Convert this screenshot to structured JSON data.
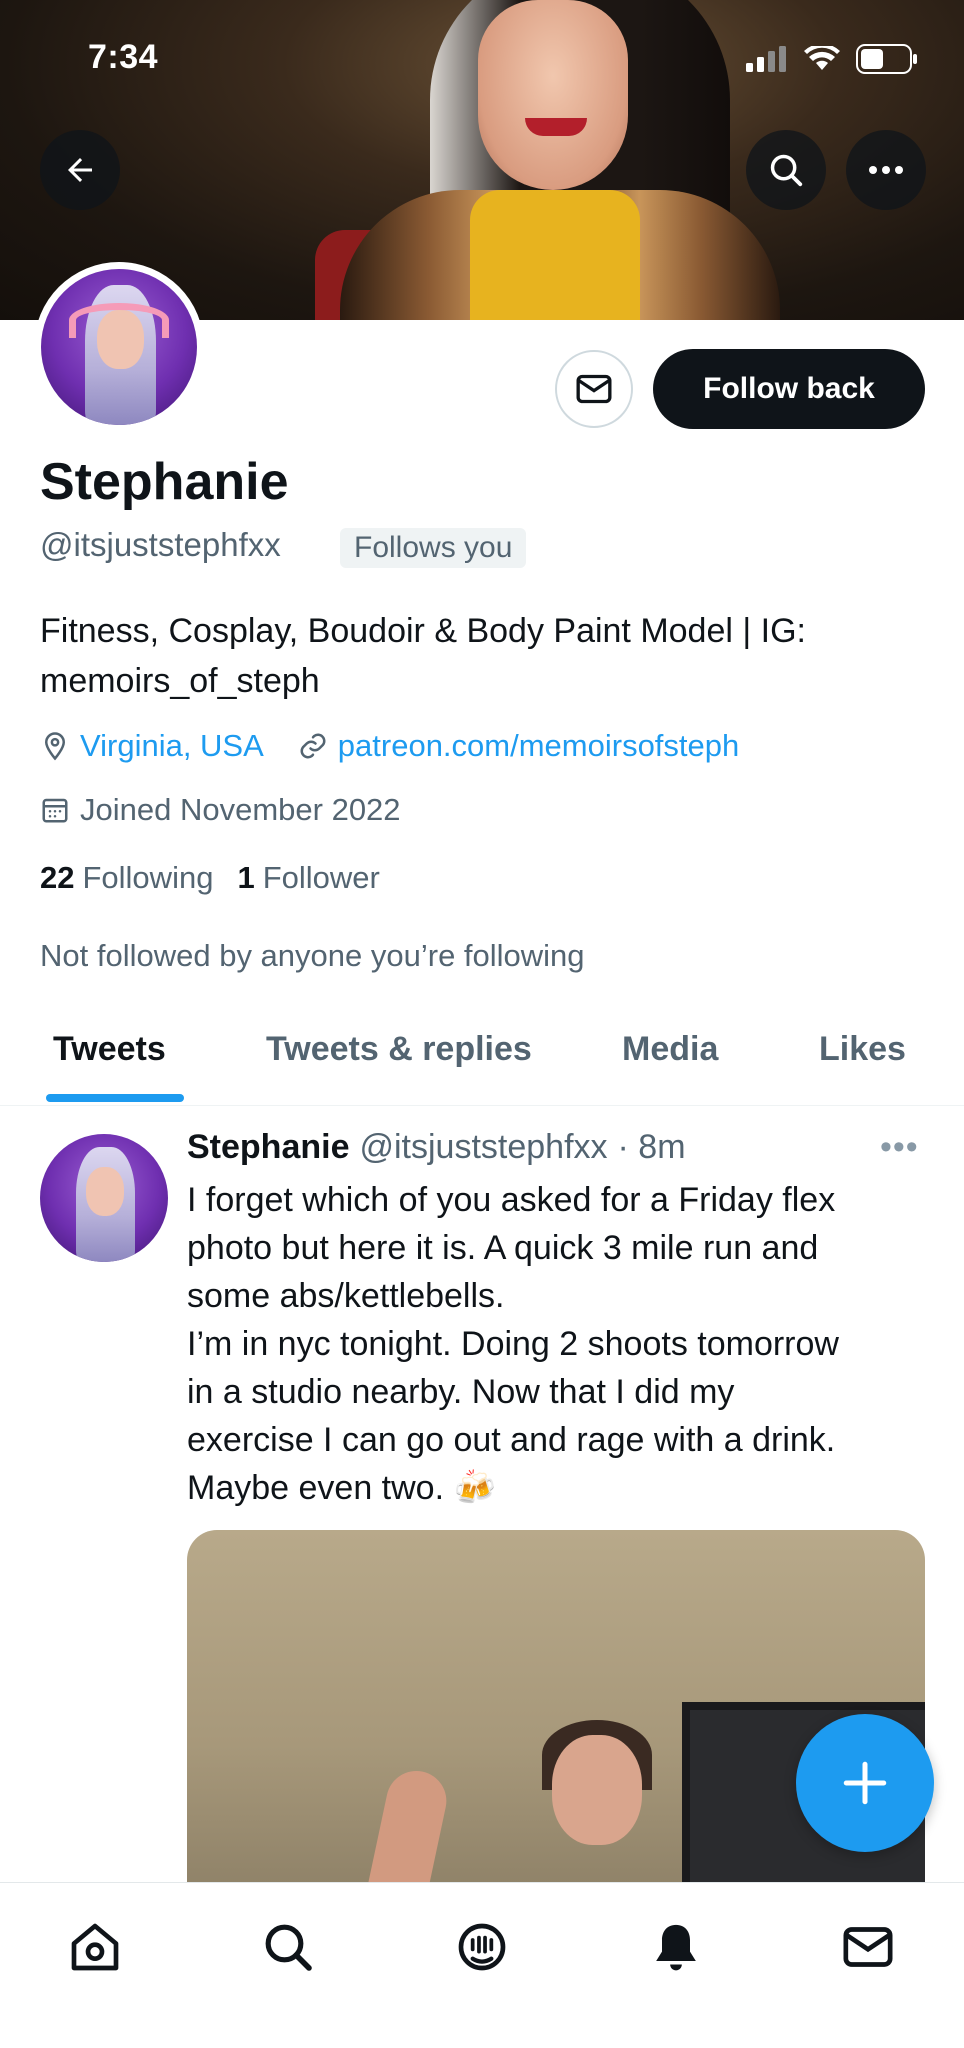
{
  "status_bar": {
    "time": "7:34"
  },
  "profile": {
    "name": "Stephanie",
    "handle": "@itsjuststephfxx",
    "follows_you_label": "Follows you",
    "follow_button_label": "Follow back",
    "bio_line1": "Fitness, Cosplay, Boudoir & Body Paint Model | IG:",
    "bio_line2": "memoirs_of_steph",
    "location": "Virginia, USA",
    "website": "patreon.com/memoirsofsteph",
    "joined": "Joined November 2022",
    "following_count": "22",
    "following_label": "Following",
    "follower_count": "1",
    "follower_label": "Follower",
    "not_followed_text": "Not followed by anyone you’re following"
  },
  "tabs": [
    {
      "label": "Tweets",
      "active": true
    },
    {
      "label": "Tweets & replies",
      "active": false
    },
    {
      "label": "Media",
      "active": false
    },
    {
      "label": "Likes",
      "active": false
    }
  ],
  "tweet": {
    "author": "Stephanie",
    "handle": "@itsjuststephfxx",
    "time": "· 8m",
    "more": "•••",
    "text": "I forget which of you asked for a Friday flex\nphoto but here it is. A quick 3 mile run and\nsome abs/kettlebells.\nI’m in nyc tonight. Doing 2 shoots tomorrow\nin a studio nearby. Now that I did my\nexercise I can go out and rage with a drink.\nMaybe even two. 🍻"
  },
  "icons": {
    "back": "back-arrow-icon",
    "search": "search-icon",
    "more": "more-icon",
    "message": "envelope-icon",
    "location": "location-pin-icon",
    "link": "link-icon",
    "calendar": "calendar-icon",
    "compose": "plus-icon",
    "nav": [
      "home-icon",
      "search-icon",
      "spaces-icon",
      "bell-icon",
      "envelope-icon"
    ]
  },
  "colors": {
    "accent": "#1d9bf0",
    "text_primary": "#0f1419",
    "text_secondary": "#536471"
  }
}
